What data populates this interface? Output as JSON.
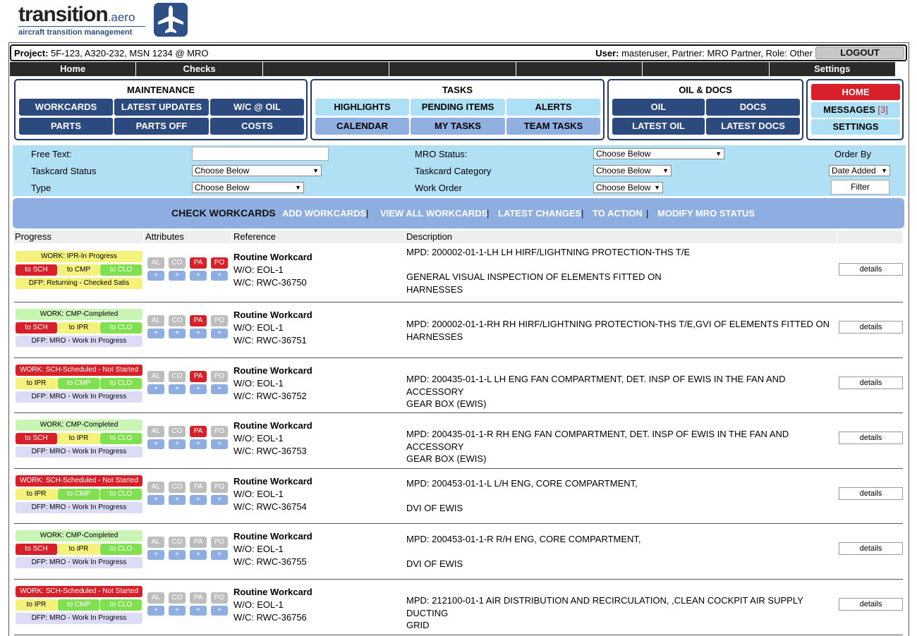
{
  "logo": {
    "word": "transition",
    "suffix": ".aero",
    "tagline": "aircraft transition management",
    "icon": "airplane-icon",
    "icon_color": "#2f5087"
  },
  "project_bar": {
    "project_label": "Project:",
    "project_value": " 5F-123, A320-232, MSN 1234 @ MRO",
    "user_label": "User:",
    "user_value": " masteruser, Partner: MRO Partner, Role: Other",
    "logout_label": "LOGOUT"
  },
  "top_nav": [
    "Home",
    "Checks",
    "",
    "",
    "",
    "",
    "Settings"
  ],
  "maintenance": {
    "title": "MAINTENANCE",
    "buttons": [
      "WORKCARDS",
      "LATEST UPDATES",
      "W/C @ OIL",
      "PARTS",
      "PARTS OFF",
      "COSTS"
    ]
  },
  "tasks": {
    "title": "TASKS",
    "buttons": [
      "HIGHLIGHTS",
      "PENDING ITEMS",
      "ALERTS",
      "CALENDAR",
      "MY TASKS",
      "TEAM TASKS"
    ]
  },
  "oil_docs": {
    "title": "OIL & DOCS",
    "buttons": [
      "OIL",
      "DOCS",
      "LATEST OIL",
      "LATEST DOCS"
    ]
  },
  "side_menu": {
    "home": "HOME",
    "messages": "MESSAGES",
    "messages_count": "[3]",
    "settings": "SETTINGS"
  },
  "filters": {
    "free_text_label": "Free Text:",
    "free_text_value": "",
    "taskcard_status_label": "Taskcard Status",
    "taskcard_status_value": "Choose Below",
    "type_label": "Type",
    "type_value": "Choose Below",
    "mro_status_label": "MRO Status:",
    "mro_status_value": "Choose Below",
    "taskcard_category_label": "Taskcard Category",
    "taskcard_category_value": "Choose Below",
    "work_order_label": "Work Order",
    "work_order_value": "Choose Below",
    "order_by_label": "Order By",
    "order_by_value": "Date Added",
    "filter_button": "Filter"
  },
  "actions": {
    "current": "CHECK WORKCARDS",
    "links": [
      "ADD WORKCARDS",
      "VIEW ALL WORKCARDS",
      "LATEST CHANGES",
      "TO ACTION",
      "MODIFY MRO STATUS"
    ],
    "separator": "|"
  },
  "table": {
    "headers": [
      "Progress",
      "Attributes",
      "Reference",
      "Description",
      ""
    ],
    "attr_labels": [
      "AL",
      "CO",
      "PA",
      "PO"
    ],
    "plus_label": "+",
    "details_label": "details",
    "rows": [
      {
        "work": "WORK: IPR-In Progress",
        "work_color": "yellow",
        "transitions": [
          {
            "label": "to SCH",
            "color": "red"
          },
          {
            "label": "to CMP",
            "color": "yellow"
          },
          {
            "label": "to CLO",
            "color": "green"
          }
        ],
        "dfp": "DFP: Returning - Checked Satis",
        "dfp_color": "yellow",
        "attrs_active": [
          false,
          false,
          true,
          true
        ],
        "ref_title": "Routine Workcard",
        "wo": "W/O: EOL-1",
        "wc": "W/C: RWC-36750",
        "desc": "MPD: 200002-01-1-LH LH HIRF/LIGHTNING PROTECTION-THS T/E\n\nGENERAL VISUAL INSPECTION OF ELEMENTS FITTED ON\nHARNESSES"
      },
      {
        "work": "WORK: CMP-Completed",
        "work_color": "green",
        "transitions": [
          {
            "label": "to SCH",
            "color": "red"
          },
          {
            "label": "to IPR",
            "color": "yellow"
          },
          {
            "label": "to CLO",
            "color": "green"
          }
        ],
        "dfp": "DFP: MRO - Work In Progress",
        "dfp_color": "lav",
        "attrs_active": [
          false,
          false,
          true,
          false
        ],
        "ref_title": "Routine Workcard",
        "wo": "W/O: EOL-1",
        "wc": "W/C: RWC-36751",
        "desc": "MPD: 200002-01-1-RH RH HIRF/LIGHTNING PROTECTION-THS T/E,GVI OF ELEMENTS FITTED ON\nHARNESSES"
      },
      {
        "work": "WORK: SCH-Scheduled - Not Started",
        "work_color": "red",
        "transitions": [
          {
            "label": "to IPR",
            "color": "yellow"
          },
          {
            "label": "to CMP",
            "color": "green"
          },
          {
            "label": "to CLO",
            "color": "green"
          }
        ],
        "dfp": "DFP: MRO - Work In Progress",
        "dfp_color": "lav",
        "attrs_active": [
          false,
          false,
          true,
          false
        ],
        "ref_title": "Routine Workcard",
        "wo": "W/O: EOL-1",
        "wc": "W/C: RWC-36752",
        "desc": "MPD: 200435-01-1-L LH ENG FAN COMPARTMENT, DET. INSP OF EWIS IN THE FAN AND ACCESSORY\nGEAR BOX (EWIS)"
      },
      {
        "work": "WORK: CMP-Completed",
        "work_color": "green",
        "transitions": [
          {
            "label": "to SCH",
            "color": "red"
          },
          {
            "label": "to IPR",
            "color": "yellow"
          },
          {
            "label": "to CLO",
            "color": "green"
          }
        ],
        "dfp": "DFP: MRO - Work In Progress",
        "dfp_color": "lav",
        "attrs_active": [
          false,
          false,
          true,
          false
        ],
        "ref_title": "Routine Workcard",
        "wo": "W/O: EOL-1",
        "wc": "W/C: RWC-36753",
        "desc": "MPD: 200435-01-1-R RH ENG FAN COMPARTMENT, DET. INSP OF EWIS IN THE FAN AND ACCESSORY\nGEAR BOX (EWIS)"
      },
      {
        "work": "WORK: SCH-Scheduled - Not Started",
        "work_color": "red",
        "transitions": [
          {
            "label": "to IPR",
            "color": "yellow"
          },
          {
            "label": "to CMP",
            "color": "green"
          },
          {
            "label": "to CLO",
            "color": "green"
          }
        ],
        "dfp": "DFP: MRO - Work In Progress",
        "dfp_color": "lav",
        "attrs_active": [
          false,
          false,
          false,
          false
        ],
        "ref_title": "Routine Workcard",
        "wo": "W/O: EOL-1",
        "wc": "W/C: RWC-36754",
        "desc": "MPD: 200453-01-1-L L/H ENG, CORE COMPARTMENT,\n\nDVI OF EWIS"
      },
      {
        "work": "WORK: CMP-Completed",
        "work_color": "green",
        "transitions": [
          {
            "label": "to SCH",
            "color": "red"
          },
          {
            "label": "to IPR",
            "color": "yellow"
          },
          {
            "label": "to CLO",
            "color": "green"
          }
        ],
        "dfp": "DFP: MRO - Work In Progress",
        "dfp_color": "lav",
        "attrs_active": [
          false,
          false,
          false,
          false
        ],
        "ref_title": "Routine Workcard",
        "wo": "W/O: EOL-1",
        "wc": "W/C: RWC-36755",
        "desc": "MPD: 200453-01-1-R R/H ENG, CORE COMPARTMENT,\n\nDVI OF EWIS"
      },
      {
        "work": "WORK: SCH-Scheduled - Not Started",
        "work_color": "red",
        "transitions": [
          {
            "label": "to IPR",
            "color": "yellow"
          },
          {
            "label": "to CMP",
            "color": "green"
          },
          {
            "label": "to CLO",
            "color": "green"
          }
        ],
        "dfp": "DFP: MRO - Work In Progress",
        "dfp_color": "lav",
        "attrs_active": [
          false,
          false,
          false,
          false
        ],
        "ref_title": "Routine Workcard",
        "wo": "W/O: EOL-1",
        "wc": "W/C: RWC-36756",
        "desc": "MPD: 212100-01-1 AIR DISTRIBUTION AND RECIRCULATION, ,CLEAN COCKPIT AIR SUPPLY DUCTING\nGRID"
      }
    ]
  },
  "colors": {
    "dark_blue": "#2c4a7e",
    "light_blue": "#aee0f5",
    "mid_blue": "#8eaee2",
    "red": "#d8202a",
    "filter_bg": "#b1e0f5"
  }
}
